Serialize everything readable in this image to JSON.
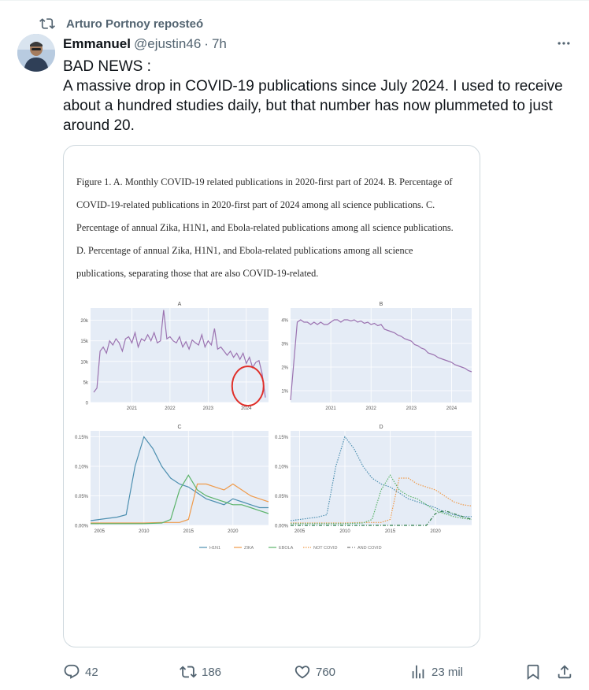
{
  "repost": {
    "text": "Arturo Portnoy reposteó"
  },
  "tweet": {
    "author_name": "Emmanuel",
    "handle": "@ejustin46",
    "separator": "·",
    "time": "7h",
    "text_line1": "BAD NEWS :",
    "text_line2": "A massive drop in COVID-19 publications since July 2024. I used to receive about a hundred studies daily, but that number has now plummeted to just around 20."
  },
  "figure": {
    "caption": "Figure 1. A. Monthly COVID-19 related publications in 2020-first part of 2024. B. Percentage of COVID-19-related publications in 2020-first part of 2024 among all science publications. C. Percentage of annual  Zika, H1N1, and Ebola-related publications among all science publications.  D. Percentage of annual Zika, H1N1, and Ebola-related publications among all science publications, separating those that are also COVID-19-related.",
    "panels": {
      "A": {
        "title": "A",
        "x_ticks": [
          "2021",
          "2022",
          "2023",
          "2024"
        ],
        "y_ticks": [
          "20k",
          "15k",
          "10k",
          "5k",
          "0"
        ]
      },
      "B": {
        "title": "B",
        "x_ticks": [
          "2021",
          "2022",
          "2023",
          "2024"
        ],
        "y_ticks": [
          "4%",
          "3%",
          "2%",
          "1%"
        ]
      },
      "C": {
        "title": "C",
        "x_ticks": [
          "2005",
          "2010",
          "2015",
          "2020"
        ],
        "y_ticks": [
          "0.15%",
          "0.10%",
          "0.05%",
          "0.00%"
        ]
      },
      "D": {
        "title": "D",
        "x_ticks": [
          "2005",
          "2010",
          "2015",
          "2020"
        ],
        "y_ticks": [
          "0.15%",
          "0.10%",
          "0.05%",
          "0.00%"
        ]
      }
    },
    "legend": [
      "H1N1",
      "ZIKA",
      "EBOLA",
      "NOT COVID",
      "AND COVID"
    ],
    "colors": {
      "plot_bg": "#e5ecf6",
      "purple": "#9b72b0",
      "h1n1": "#4d8fb0",
      "zika": "#ef9a4a",
      "ebola": "#5bb36a",
      "annotation_red": "#e0302a"
    }
  },
  "chart_data": [
    {
      "type": "line",
      "title": "A",
      "xlabel": "",
      "ylabel": "",
      "x_unit": "month index from Jan 2020",
      "ylim": [
        0,
        22000
      ],
      "series": [
        {
          "name": "",
          "x": [
            0,
            1,
            2,
            3,
            4,
            5,
            6,
            7,
            8,
            9,
            10,
            11,
            12,
            13,
            14,
            15,
            16,
            17,
            18,
            19,
            20,
            21,
            22,
            23,
            24,
            25,
            26,
            27,
            28,
            29,
            30,
            31,
            32,
            33,
            34,
            35,
            36,
            37,
            38,
            39,
            40,
            41,
            42,
            43,
            44,
            45,
            46,
            47,
            48,
            49,
            50,
            51,
            52,
            53,
            54
          ],
          "values": [
            2500,
            3500,
            12500,
            13500,
            12000,
            15000,
            14000,
            15500,
            14500,
            12500,
            15500,
            16000,
            14500,
            17000,
            13500,
            15500,
            15000,
            16500,
            15000,
            17000,
            14500,
            15000,
            22500,
            15500,
            16000,
            15000,
            14500,
            16000,
            13500,
            14800,
            13000,
            15200,
            14500,
            14000,
            16500,
            13500,
            15000,
            14000,
            18000,
            13000,
            13500,
            12500,
            11500,
            12500,
            11000,
            12000,
            10500,
            12000,
            9500,
            11000,
            8500,
            9800,
            10200,
            7000,
            1200
          ]
        }
      ]
    },
    {
      "type": "line",
      "title": "B",
      "xlabel": "",
      "ylabel": "",
      "x_unit": "month index from Jan 2020",
      "ylim": [
        0.5,
        4.5
      ],
      "series": [
        {
          "name": "",
          "x": [
            0,
            2,
            3,
            4,
            5,
            6,
            7,
            8,
            9,
            10,
            11,
            12,
            13,
            14,
            15,
            16,
            17,
            18,
            19,
            20,
            21,
            22,
            23,
            24,
            25,
            26,
            27,
            28,
            29,
            30,
            31,
            32,
            33,
            34,
            35,
            36,
            37,
            38,
            39,
            40,
            41,
            42,
            43,
            44,
            45,
            46,
            47,
            48,
            49,
            50,
            51,
            52,
            53,
            54
          ],
          "values": [
            0.6,
            3.9,
            4.0,
            3.9,
            3.9,
            3.8,
            3.9,
            3.8,
            3.9,
            3.8,
            3.8,
            3.9,
            4.0,
            4.0,
            3.9,
            4.0,
            4.0,
            3.95,
            4.0,
            3.9,
            3.95,
            3.85,
            3.9,
            3.8,
            3.85,
            3.75,
            3.8,
            3.6,
            3.55,
            3.5,
            3.45,
            3.35,
            3.3,
            3.2,
            3.15,
            3.1,
            2.95,
            2.9,
            2.8,
            2.75,
            2.6,
            2.55,
            2.5,
            2.4,
            2.35,
            2.3,
            2.25,
            2.2,
            2.1,
            2.05,
            2.0,
            1.95,
            1.85,
            1.8
          ]
        }
      ]
    },
    {
      "type": "line",
      "title": "C",
      "xlabel": "",
      "ylabel": "",
      "ylim": [
        0,
        0.16
      ],
      "series": [
        {
          "name": "H1N1",
          "x": [
            2004,
            2005,
            2006,
            2007,
            2008,
            2009,
            2010,
            2011,
            2012,
            2013,
            2014,
            2015,
            2016,
            2017,
            2018,
            2019,
            2020,
            2021,
            2022,
            2023,
            2024
          ],
          "values": [
            0.008,
            0.01,
            0.012,
            0.014,
            0.018,
            0.1,
            0.15,
            0.13,
            0.1,
            0.08,
            0.07,
            0.065,
            0.055,
            0.045,
            0.04,
            0.035,
            0.045,
            0.04,
            0.035,
            0.03,
            0.03
          ]
        },
        {
          "name": "ZIKA",
          "x": [
            2004,
            2006,
            2008,
            2010,
            2012,
            2014,
            2015,
            2016,
            2017,
            2018,
            2019,
            2020,
            2021,
            2022,
            2023,
            2024
          ],
          "values": [
            0.004,
            0.004,
            0.004,
            0.004,
            0.005,
            0.005,
            0.01,
            0.07,
            0.07,
            0.065,
            0.06,
            0.07,
            0.06,
            0.05,
            0.045,
            0.04
          ]
        },
        {
          "name": "EBOLA",
          "x": [
            2004,
            2006,
            2008,
            2010,
            2012,
            2013,
            2014,
            2015,
            2016,
            2017,
            2018,
            2019,
            2020,
            2021,
            2022,
            2023,
            2024
          ],
          "values": [
            0.003,
            0.003,
            0.003,
            0.003,
            0.004,
            0.01,
            0.06,
            0.085,
            0.06,
            0.05,
            0.045,
            0.04,
            0.035,
            0.035,
            0.03,
            0.025,
            0.02
          ]
        }
      ]
    },
    {
      "type": "line",
      "title": "D",
      "xlabel": "",
      "ylabel": "",
      "ylim": [
        0,
        0.16
      ],
      "series": [
        {
          "name": "H1N1",
          "x": [
            2004,
            2005,
            2006,
            2007,
            2008,
            2009,
            2010,
            2011,
            2012,
            2013,
            2014,
            2015,
            2016,
            2017,
            2018,
            2019,
            2020,
            2021,
            2022,
            2023,
            2024
          ],
          "values": [
            0.008,
            0.01,
            0.012,
            0.014,
            0.018,
            0.1,
            0.15,
            0.13,
            0.1,
            0.08,
            0.07,
            0.065,
            0.055,
            0.045,
            0.04,
            0.035,
            0.03,
            0.022,
            0.018,
            0.015,
            0.015
          ]
        },
        {
          "name": "ZIKA",
          "x": [
            2004,
            2006,
            2008,
            2010,
            2012,
            2014,
            2015,
            2016,
            2017,
            2018,
            2019,
            2020,
            2021,
            2022,
            2023,
            2024
          ],
          "values": [
            0.004,
            0.004,
            0.004,
            0.004,
            0.005,
            0.005,
            0.01,
            0.08,
            0.08,
            0.07,
            0.065,
            0.06,
            0.05,
            0.04,
            0.035,
            0.033
          ]
        },
        {
          "name": "EBOLA",
          "x": [
            2004,
            2006,
            2008,
            2010,
            2012,
            2013,
            2014,
            2015,
            2016,
            2017,
            2018,
            2019,
            2020,
            2021,
            2022,
            2023,
            2024
          ],
          "values": [
            0.003,
            0.003,
            0.003,
            0.003,
            0.004,
            0.01,
            0.06,
            0.085,
            0.06,
            0.05,
            0.045,
            0.035,
            0.025,
            0.02,
            0.015,
            0.012,
            0.01
          ]
        },
        {
          "name": "AND COVID",
          "x": [
            2004,
            2018,
            2019,
            2020,
            2021,
            2022,
            2023,
            2024
          ],
          "values": [
            0,
            0,
            0,
            0.02,
            0.025,
            0.02,
            0.015,
            0.01
          ]
        }
      ]
    }
  ],
  "actions": {
    "reply_count": "42",
    "repost_count": "186",
    "like_count": "760",
    "view_count": "23 mil"
  }
}
